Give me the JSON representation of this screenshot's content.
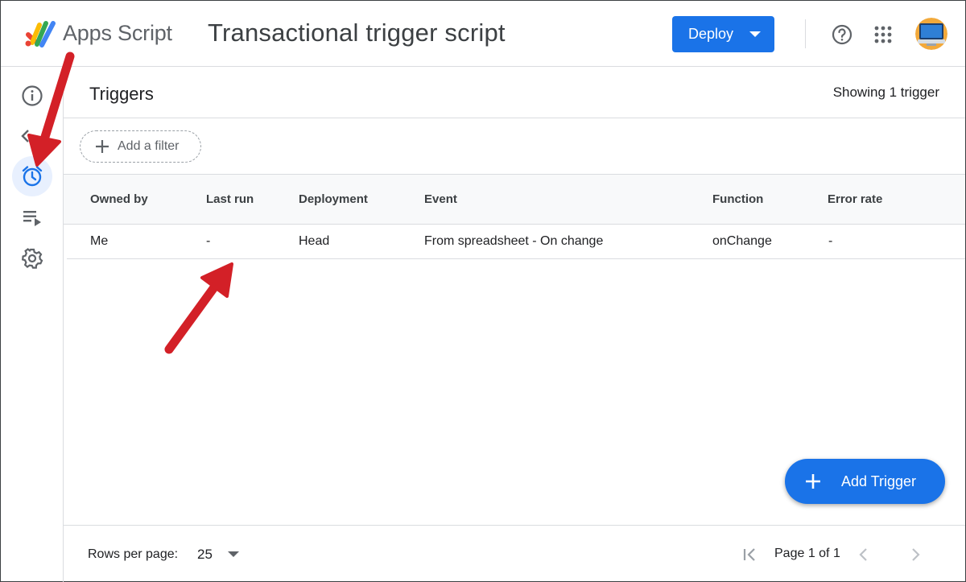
{
  "header": {
    "app_name": "Apps Script",
    "project_title": "Transactional trigger script",
    "deploy_label": "Deploy"
  },
  "sidebar": {
    "items": [
      {
        "icon": "info-icon",
        "active": false
      },
      {
        "icon": "chevron-left-icon",
        "active": false
      },
      {
        "icon": "alarm-clock-icon",
        "active": true
      },
      {
        "icon": "executions-icon",
        "active": false
      },
      {
        "icon": "gear-icon",
        "active": false
      }
    ]
  },
  "main": {
    "title": "Triggers",
    "count_text": "Showing 1 trigger",
    "filter_label": "Add a filter",
    "columns": [
      "Owned by",
      "Last run",
      "Deployment",
      "Event",
      "Function",
      "Error rate"
    ],
    "rows": [
      [
        "Me",
        "-",
        "Head",
        "From spreadsheet - On change",
        "onChange",
        "-"
      ]
    ],
    "add_trigger_label": "Add Trigger"
  },
  "footer": {
    "rows_per_page_label": "Rows per page:",
    "rows_per_page_value": "25",
    "page_label": "Page 1 of 1"
  },
  "colors": {
    "accent": "#1a73e8",
    "annotation_arrow": "#d32027"
  }
}
